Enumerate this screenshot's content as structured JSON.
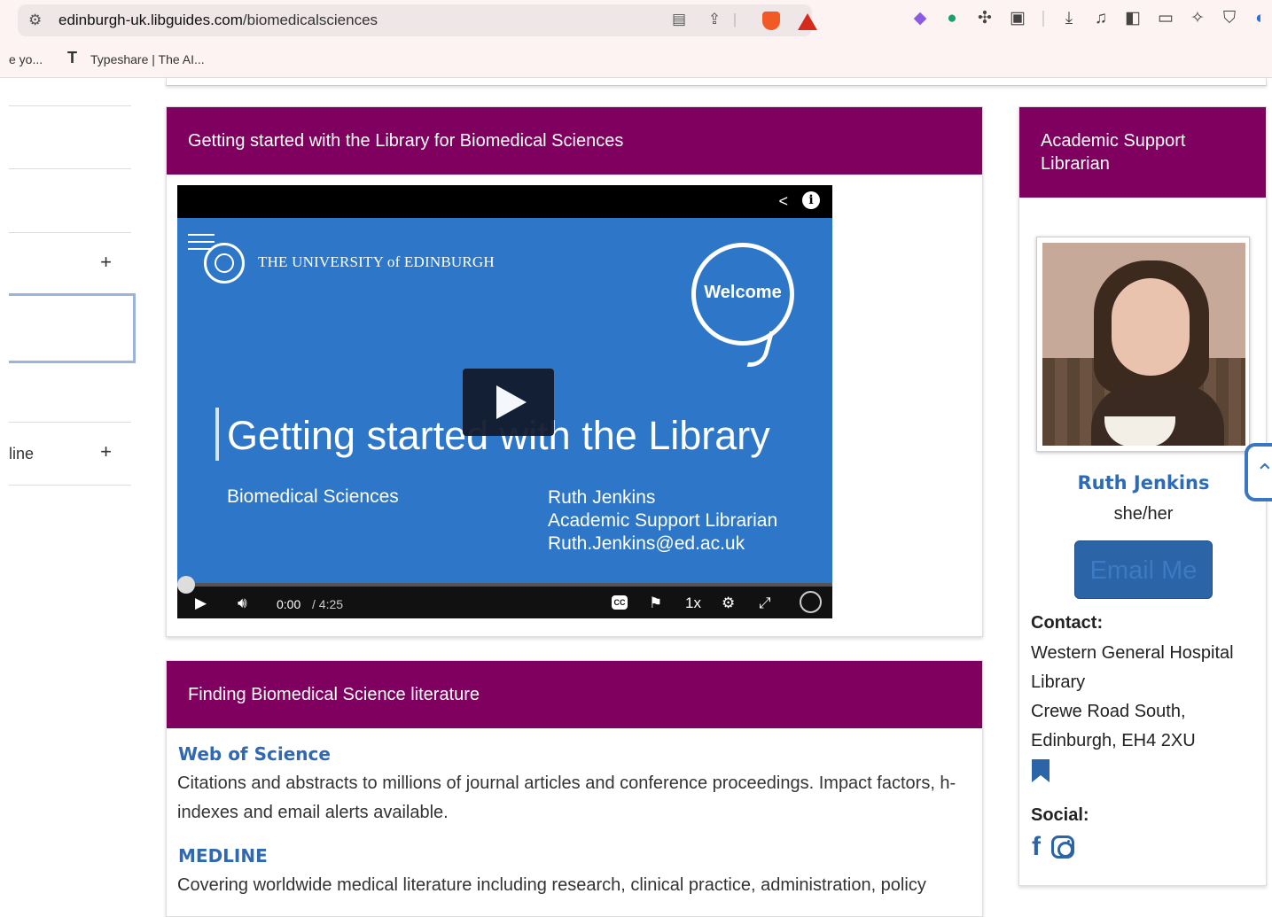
{
  "browser": {
    "url_domain": "edinburgh-uk.libguides.com",
    "url_path": "/biomedicalsciences",
    "bookmarks": [
      {
        "label": "e yo..."
      },
      {
        "icon_text": "T",
        "label": "Typeshare | The AI..."
      }
    ],
    "icons": [
      "tune-icon",
      "reader-icon",
      "share-icon",
      "brave-shield-icon",
      "brave-rewards-icon",
      "extension-diamond-icon",
      "grammarly-icon",
      "puzzle-icon",
      "page-search-icon",
      "download-icon",
      "music-icon",
      "sidebar-icon",
      "wallet-icon",
      "sparkle-icon",
      "vpn-shield-icon",
      "profile-icon"
    ]
  },
  "nav": {
    "items": [
      {
        "label": "",
        "has_plus": false
      },
      {
        "label": "",
        "has_plus": false
      },
      {
        "label": "",
        "has_plus": true
      },
      {
        "label": "",
        "has_plus": false,
        "active": true
      },
      {
        "label": "",
        "has_plus": false
      },
      {
        "label": "line",
        "has_plus": true
      }
    ],
    "plus": "+"
  },
  "video_box": {
    "title": "Getting started with the Library for Biomedical Sciences",
    "video": {
      "university": "THE UNIVERSITY of EDINBURGH",
      "welcome": "Welcome",
      "title": "Getting started with the Library",
      "department": "Biomedical Sciences",
      "author_name": "Ruth Jenkins",
      "author_role": "Academic Support Librarian",
      "author_email": "Ruth.Jenkins@ed.ac.uk",
      "time_current": "0:00",
      "time_duration": "/ 4:25",
      "progress": 0,
      "cc": "CC",
      "speed": "1x"
    }
  },
  "literature_box": {
    "title": "Finding Biomedical Science literature",
    "items": [
      {
        "title": "Web of Science",
        "description": "Citations and abstracts to millions of journal articles and conference proceedings. Impact factors, h-indexes and email alerts available."
      },
      {
        "title": "MEDLINE",
        "description": "Covering worldwide medical literature including research, clinical practice, administration, policy"
      }
    ]
  },
  "profile_box": {
    "title": "Academic Support Librarian",
    "name": "Ruth Jenkins",
    "pronouns": "she/her",
    "email_button": "Email Me",
    "contact_heading": "Contact:",
    "contact_lines": [
      "Western General Hospital",
      "Library",
      "Crewe Road South,",
      "Edinburgh, EH4 2XU"
    ],
    "social_heading": "Social:"
  },
  "colors": {
    "accent": "#800060",
    "link": "#2c6bb8",
    "video_slide": "#2e77c8"
  }
}
